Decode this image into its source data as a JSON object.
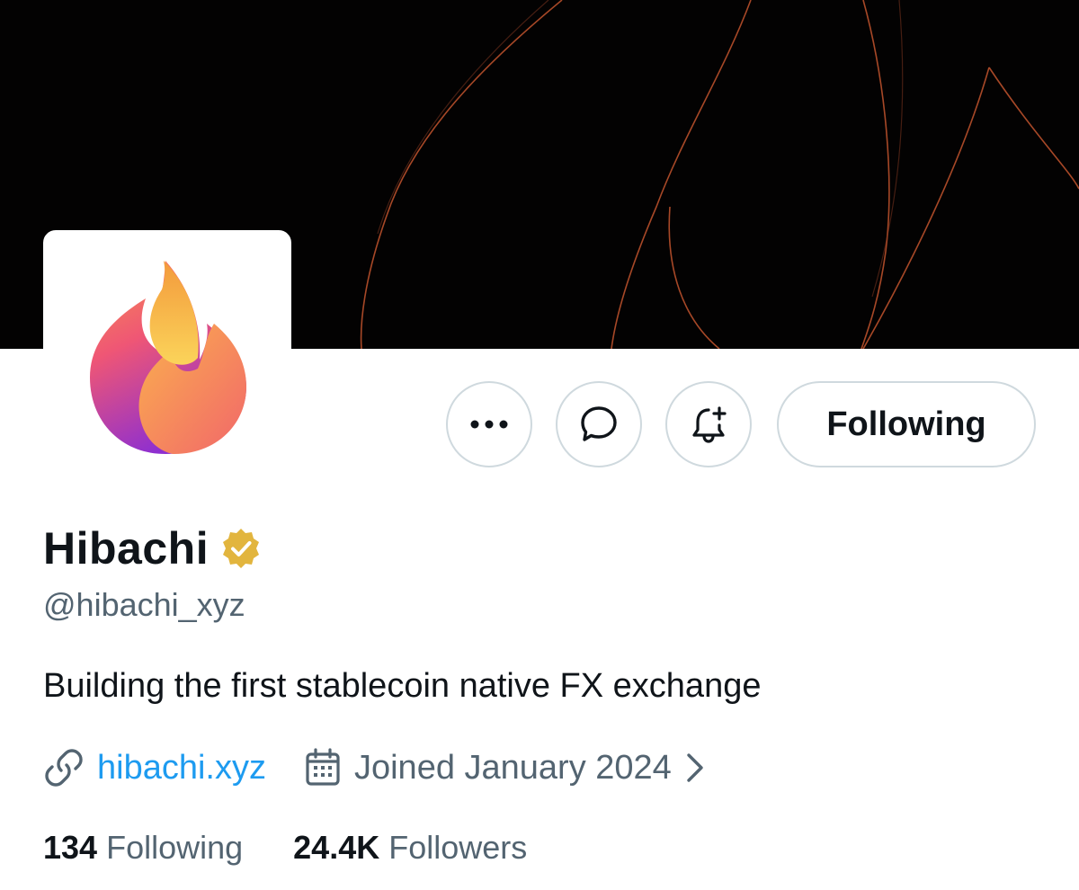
{
  "profile": {
    "display_name": "Hibachi",
    "verified_badge_icon": "gold-verified-badge-icon",
    "handle": "@hibachi_xyz",
    "bio": "Building the first stablecoin native FX exchange",
    "website": "hibachi.xyz",
    "joined": "Joined January 2024",
    "stats": {
      "following_count": "134",
      "following_label": "Following",
      "followers_count": "24.4K",
      "followers_label": "Followers"
    }
  },
  "actions": {
    "more_icon": "more-horizontal-icon",
    "message_icon": "message-bubble-icon",
    "notify_icon": "bell-plus-icon",
    "following_label": "Following"
  },
  "icons": {
    "link": "link-icon",
    "calendar": "calendar-icon",
    "chevron": "chevron-right-icon"
  },
  "colors": {
    "banner_background": "#030202",
    "banner_lines": "#c4552e",
    "link": "#1d9bf0",
    "secondary_text": "#536471",
    "verified_gold": "#e2b53e"
  }
}
